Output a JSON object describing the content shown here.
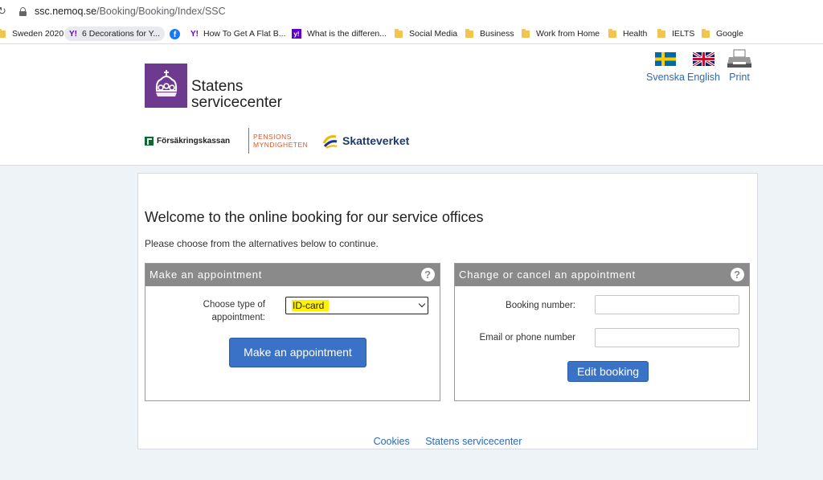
{
  "browser": {
    "url_host": "ssc.nemoq.se",
    "url_path": "/Booking/Booking/Index/SSC",
    "bookmarks": [
      {
        "label": "Sweden 2020",
        "icon": "folder-icon"
      },
      {
        "label": "6 Decorations for Y...",
        "icon": "yahoo-icon"
      },
      {
        "label": "",
        "icon": "facebook-icon"
      },
      {
        "label": "How To Get A Flat B...",
        "icon": "yahoo-icon"
      },
      {
        "label": "What is the differen...",
        "icon": "yahoo-square-icon"
      },
      {
        "label": "Social Media",
        "icon": "folder-icon"
      },
      {
        "label": "Business",
        "icon": "folder-icon"
      },
      {
        "label": "Work from Home",
        "icon": "folder-icon"
      },
      {
        "label": "Health",
        "icon": "folder-icon"
      },
      {
        "label": "IELTS",
        "icon": "folder-icon"
      },
      {
        "label": "Google",
        "icon": "folder-icon"
      }
    ]
  },
  "header": {
    "logo_line1": "Statens",
    "logo_line2": "servicecenter",
    "agencies": {
      "forsakringskassan": "Försäkringskassan",
      "pensions_line1": "PENSIONS",
      "pensions_line2": "MYNDIGHETEN",
      "skatteverket": "Skatteverket"
    },
    "languages": {
      "svenska": "Svenska",
      "english": "English",
      "print": "Print"
    }
  },
  "main": {
    "welcome": "Welcome to the online booking for our service offices",
    "intro": "Please choose from the alternatives below to continue.",
    "make_panel": {
      "title": "Make an appointment",
      "help": "?",
      "type_label_line1": "Choose type of",
      "type_label_line2": "appointment:",
      "selected_type": "ID-card",
      "button": "Make an appointment"
    },
    "change_panel": {
      "title": "Change or cancel an appointment",
      "help": "?",
      "booking_label": "Booking number:",
      "booking_value": "",
      "email_label": "Email or phone number",
      "email_value": "",
      "button": "Edit booking"
    }
  },
  "footer": {
    "cookies": "Cookies",
    "ssc": "Statens servicecenter"
  },
  "colors": {
    "accent_blue": "#3a72c8",
    "panel_header": "#8a8a8a",
    "logo_purple": "#6e3a8f",
    "highlight": "#fff200"
  }
}
